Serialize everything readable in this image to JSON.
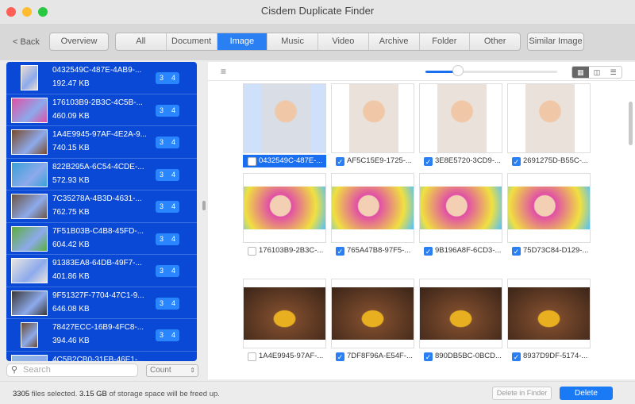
{
  "window": {
    "title": "Cisdem Duplicate Finder"
  },
  "toolbar": {
    "back": "< Back",
    "overview": "Overview",
    "tabs": [
      "All",
      "Document",
      "Image",
      "Music",
      "Video",
      "Archive",
      "Folder",
      "Other"
    ],
    "active_tab": "Image",
    "similar": "Similar Image"
  },
  "groups": [
    {
      "name": "0432549C-487E-4AB9-...",
      "size": "192.47 KB",
      "c1": "3",
      "c2": "4",
      "color": "#e9dcd2"
    },
    {
      "name": "176103B9-2B3C-4C5B-...",
      "size": "460.09 KB",
      "c1": "3",
      "c2": "4",
      "color": "#e14fa6"
    },
    {
      "name": "1A4E9945-97AF-4E2A-9...",
      "size": "740.15 KB",
      "c1": "3",
      "c2": "4",
      "color": "#7a4a2c"
    },
    {
      "name": "822B295A-6C54-4CDE-...",
      "size": "572.93 KB",
      "c1": "3",
      "c2": "4",
      "color": "#3aa0d8"
    },
    {
      "name": "7C35278A-4B3D-4631-...",
      "size": "762.75 KB",
      "c1": "3",
      "c2": "4",
      "color": "#6b5544"
    },
    {
      "name": "7F51B03B-C4B8-45FD-...",
      "size": "604.42 KB",
      "c1": "3",
      "c2": "4",
      "color": "#5cae3c"
    },
    {
      "name": "91383EA8-64DB-49F7-...",
      "size": "401.86 KB",
      "c1": "3",
      "c2": "4",
      "color": "#e8e4e0"
    },
    {
      "name": "9F51327F-7704-47C1-9...",
      "size": "646.08 KB",
      "c1": "3",
      "c2": "4",
      "color": "#3a3838"
    },
    {
      "name": "78427ECC-16B9-4FC8-...",
      "size": "394.46 KB",
      "c1": "3",
      "c2": "4",
      "color": "#6a4a30"
    },
    {
      "name": "4C5B2CB0-31FB-46E1-...",
      "size": "",
      "c1": "",
      "c2": "",
      "color": "#8fb8e0"
    }
  ],
  "search": {
    "placeholder": "Search"
  },
  "sort": {
    "value": "Count"
  },
  "grid": [
    {
      "name": "0432549C-487E-...",
      "checked": false,
      "selected": true,
      "color": "#d8dde6"
    },
    {
      "name": "AF5C15E9-1725-...",
      "checked": true,
      "color": "#eae2da"
    },
    {
      "name": "3E8E5720-3CD9-...",
      "checked": true,
      "color": "#eae2da"
    },
    {
      "name": "2691275D-B55C-...",
      "checked": true,
      "color": "#eae2da"
    },
    {
      "name": "176103B9-2B3C-...",
      "checked": false,
      "color": "#e14fa6"
    },
    {
      "name": "765A47B8-97F5-...",
      "checked": true,
      "color": "#e14fa6"
    },
    {
      "name": "9B196A8F-6CD3-...",
      "checked": true,
      "color": "#e14fa6"
    },
    {
      "name": "75D73C84-D129-...",
      "checked": true,
      "color": "#e14fa6"
    },
    {
      "name": "1A4E9945-97AF-...",
      "checked": false,
      "color": "#7a4a2c"
    },
    {
      "name": "7DF8F96A-E54F-...",
      "checked": true,
      "color": "#7a4a2c"
    },
    {
      "name": "890DB5BC-0BCD...",
      "checked": true,
      "color": "#7a4a2c"
    },
    {
      "name": "8937D9DF-5174-...",
      "checked": true,
      "color": "#7a4a2c"
    }
  ],
  "status": {
    "count": "3305",
    "mid": " files selected. ",
    "size": "3.15 GB",
    "tail": " of storage space will be freed up.",
    "delete_in_finder": "Delete in Finder",
    "delete": "Delete"
  },
  "accent": "#0a49d6"
}
